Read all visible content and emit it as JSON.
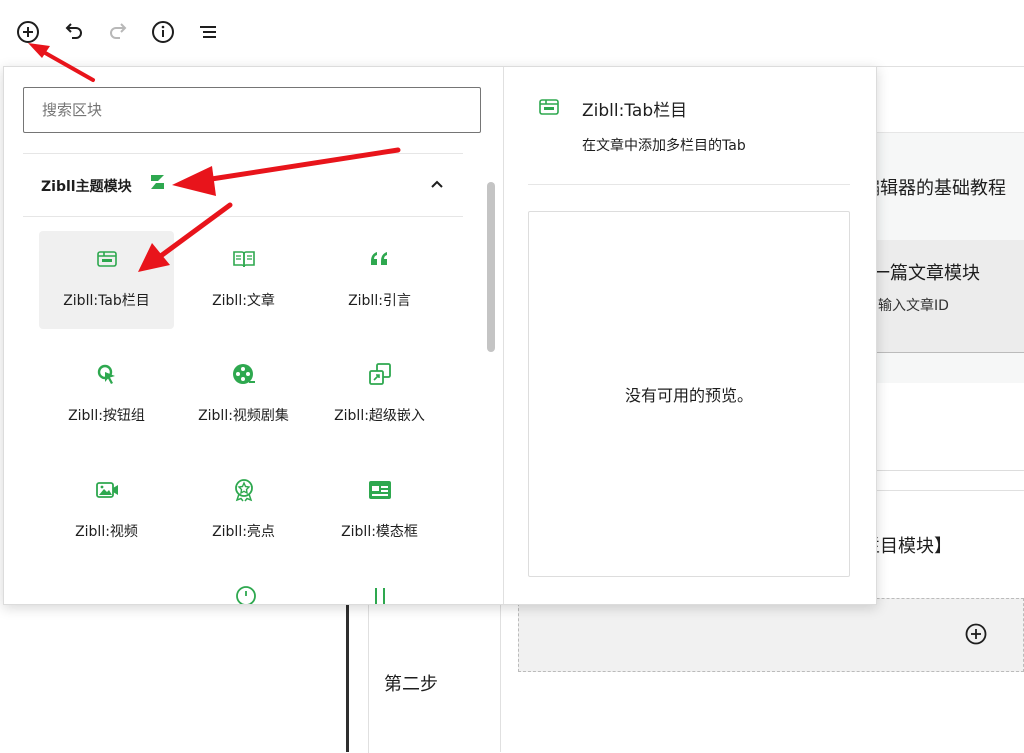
{
  "toolbar": {
    "buttons": [
      {
        "name": "add-block-button",
        "icon": "plus-circle-icon"
      },
      {
        "name": "undo-button",
        "icon": "undo-icon"
      },
      {
        "name": "redo-button",
        "icon": "redo-icon"
      },
      {
        "name": "details-button",
        "icon": "info-icon"
      },
      {
        "name": "list-view-button",
        "icon": "list-view-icon"
      }
    ]
  },
  "inserter": {
    "search_placeholder": "搜索区块",
    "category": {
      "title": "Zibll主题模块",
      "collapse_icon": "chevron-up-icon"
    },
    "blocks": [
      {
        "label": "Zibll:Tab栏目",
        "icon": "tab-icon",
        "selected": true
      },
      {
        "label": "Zibll:文章",
        "icon": "book-icon",
        "selected": false
      },
      {
        "label": "Zibll:引言",
        "icon": "quote-icon",
        "selected": false
      },
      {
        "label": "Zibll:按钮组",
        "icon": "cursor-click-icon",
        "selected": false
      },
      {
        "label": "Zibll:视频剧集",
        "icon": "film-reel-icon",
        "selected": false
      },
      {
        "label": "Zibll:超级嵌入",
        "icon": "embed-icon",
        "selected": false
      },
      {
        "label": "Zibll:视频",
        "icon": "video-icon",
        "selected": false
      },
      {
        "label": "Zibll:亮点",
        "icon": "badge-icon",
        "selected": false
      },
      {
        "label": "Zibll:模态框",
        "icon": "modal-window-icon",
        "selected": false
      }
    ],
    "preview": {
      "title": "Zibll:Tab栏目",
      "description": "在文章中添加多栏目的Tab",
      "empty_text": "没有可用的预览。"
    }
  },
  "background": {
    "article_title": "编辑器的基础教程",
    "card_title": "一篇文章模块",
    "card_subtitle": "输入文章ID",
    "tab_block_title": "栏目模块】",
    "step_label": "第二步"
  },
  "colors": {
    "accent_green": "#2ea84f",
    "arrow_red": "#e8141b",
    "text": "#1e1e1e"
  }
}
